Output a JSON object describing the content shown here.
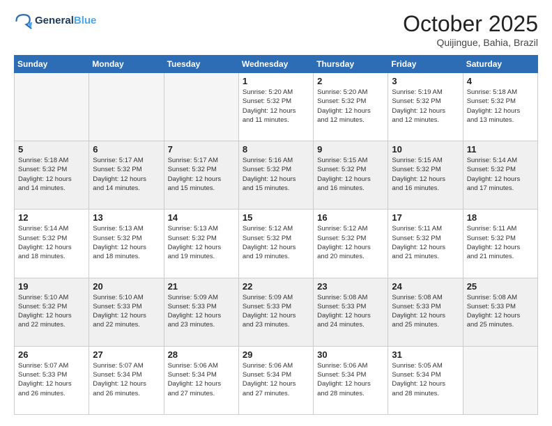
{
  "logo": {
    "line1": "General",
    "line2": "Blue"
  },
  "title": "October 2025",
  "subtitle": "Quijingue, Bahia, Brazil",
  "days_of_week": [
    "Sunday",
    "Monday",
    "Tuesday",
    "Wednesday",
    "Thursday",
    "Friday",
    "Saturday"
  ],
  "weeks": [
    [
      {
        "day": "",
        "info": ""
      },
      {
        "day": "",
        "info": ""
      },
      {
        "day": "",
        "info": ""
      },
      {
        "day": "1",
        "info": "Sunrise: 5:20 AM\nSunset: 5:32 PM\nDaylight: 12 hours\nand 11 minutes."
      },
      {
        "day": "2",
        "info": "Sunrise: 5:20 AM\nSunset: 5:32 PM\nDaylight: 12 hours\nand 12 minutes."
      },
      {
        "day": "3",
        "info": "Sunrise: 5:19 AM\nSunset: 5:32 PM\nDaylight: 12 hours\nand 12 minutes."
      },
      {
        "day": "4",
        "info": "Sunrise: 5:18 AM\nSunset: 5:32 PM\nDaylight: 12 hours\nand 13 minutes."
      }
    ],
    [
      {
        "day": "5",
        "info": "Sunrise: 5:18 AM\nSunset: 5:32 PM\nDaylight: 12 hours\nand 14 minutes."
      },
      {
        "day": "6",
        "info": "Sunrise: 5:17 AM\nSunset: 5:32 PM\nDaylight: 12 hours\nand 14 minutes."
      },
      {
        "day": "7",
        "info": "Sunrise: 5:17 AM\nSunset: 5:32 PM\nDaylight: 12 hours\nand 15 minutes."
      },
      {
        "day": "8",
        "info": "Sunrise: 5:16 AM\nSunset: 5:32 PM\nDaylight: 12 hours\nand 15 minutes."
      },
      {
        "day": "9",
        "info": "Sunrise: 5:15 AM\nSunset: 5:32 PM\nDaylight: 12 hours\nand 16 minutes."
      },
      {
        "day": "10",
        "info": "Sunrise: 5:15 AM\nSunset: 5:32 PM\nDaylight: 12 hours\nand 16 minutes."
      },
      {
        "day": "11",
        "info": "Sunrise: 5:14 AM\nSunset: 5:32 PM\nDaylight: 12 hours\nand 17 minutes."
      }
    ],
    [
      {
        "day": "12",
        "info": "Sunrise: 5:14 AM\nSunset: 5:32 PM\nDaylight: 12 hours\nand 18 minutes."
      },
      {
        "day": "13",
        "info": "Sunrise: 5:13 AM\nSunset: 5:32 PM\nDaylight: 12 hours\nand 18 minutes."
      },
      {
        "day": "14",
        "info": "Sunrise: 5:13 AM\nSunset: 5:32 PM\nDaylight: 12 hours\nand 19 minutes."
      },
      {
        "day": "15",
        "info": "Sunrise: 5:12 AM\nSunset: 5:32 PM\nDaylight: 12 hours\nand 19 minutes."
      },
      {
        "day": "16",
        "info": "Sunrise: 5:12 AM\nSunset: 5:32 PM\nDaylight: 12 hours\nand 20 minutes."
      },
      {
        "day": "17",
        "info": "Sunrise: 5:11 AM\nSunset: 5:32 PM\nDaylight: 12 hours\nand 21 minutes."
      },
      {
        "day": "18",
        "info": "Sunrise: 5:11 AM\nSunset: 5:32 PM\nDaylight: 12 hours\nand 21 minutes."
      }
    ],
    [
      {
        "day": "19",
        "info": "Sunrise: 5:10 AM\nSunset: 5:32 PM\nDaylight: 12 hours\nand 22 minutes."
      },
      {
        "day": "20",
        "info": "Sunrise: 5:10 AM\nSunset: 5:33 PM\nDaylight: 12 hours\nand 22 minutes."
      },
      {
        "day": "21",
        "info": "Sunrise: 5:09 AM\nSunset: 5:33 PM\nDaylight: 12 hours\nand 23 minutes."
      },
      {
        "day": "22",
        "info": "Sunrise: 5:09 AM\nSunset: 5:33 PM\nDaylight: 12 hours\nand 23 minutes."
      },
      {
        "day": "23",
        "info": "Sunrise: 5:08 AM\nSunset: 5:33 PM\nDaylight: 12 hours\nand 24 minutes."
      },
      {
        "day": "24",
        "info": "Sunrise: 5:08 AM\nSunset: 5:33 PM\nDaylight: 12 hours\nand 25 minutes."
      },
      {
        "day": "25",
        "info": "Sunrise: 5:08 AM\nSunset: 5:33 PM\nDaylight: 12 hours\nand 25 minutes."
      }
    ],
    [
      {
        "day": "26",
        "info": "Sunrise: 5:07 AM\nSunset: 5:33 PM\nDaylight: 12 hours\nand 26 minutes."
      },
      {
        "day": "27",
        "info": "Sunrise: 5:07 AM\nSunset: 5:34 PM\nDaylight: 12 hours\nand 26 minutes."
      },
      {
        "day": "28",
        "info": "Sunrise: 5:06 AM\nSunset: 5:34 PM\nDaylight: 12 hours\nand 27 minutes."
      },
      {
        "day": "29",
        "info": "Sunrise: 5:06 AM\nSunset: 5:34 PM\nDaylight: 12 hours\nand 27 minutes."
      },
      {
        "day": "30",
        "info": "Sunrise: 5:06 AM\nSunset: 5:34 PM\nDaylight: 12 hours\nand 28 minutes."
      },
      {
        "day": "31",
        "info": "Sunrise: 5:05 AM\nSunset: 5:34 PM\nDaylight: 12 hours\nand 28 minutes."
      },
      {
        "day": "",
        "info": ""
      }
    ]
  ]
}
